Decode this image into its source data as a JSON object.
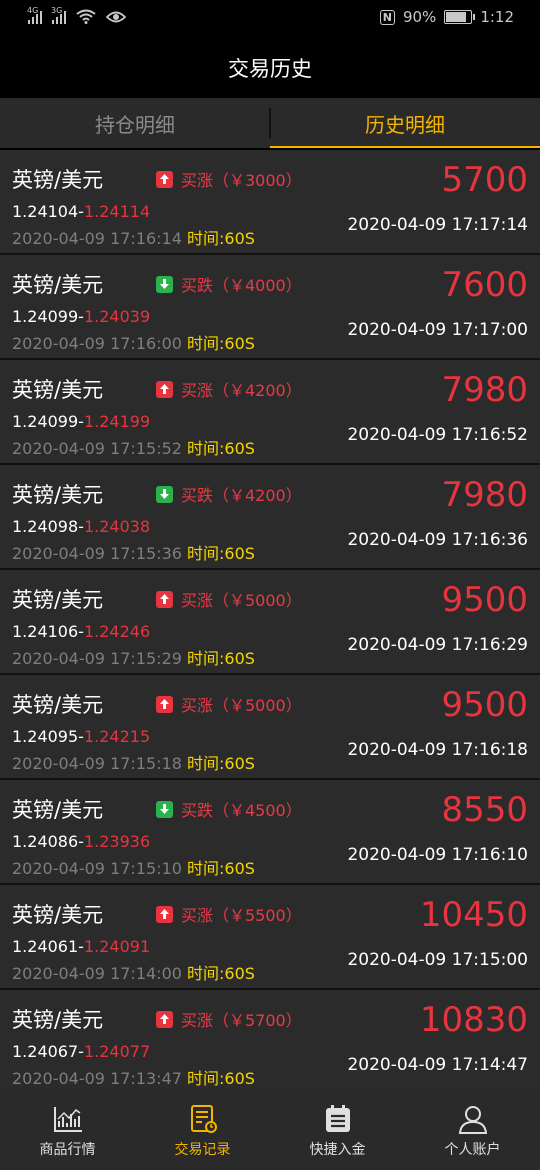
{
  "status_bar": {
    "signal1_tag": "4G",
    "signal2_tag": "3G",
    "battery_percent": "90%",
    "battery_level": 0.9,
    "time": "1:12"
  },
  "header": {
    "title": "交易历史"
  },
  "tabs": [
    {
      "label": "持仓明细",
      "active": false
    },
    {
      "label": "历史明细",
      "active": true
    }
  ],
  "duration_label": "时间:60S",
  "trades": [
    {
      "pair": "英镑/美元",
      "direction": "up",
      "dir_label": "买涨（￥3000）",
      "amount": "5700",
      "open_price": "1.24104",
      "close_price": "1.24114",
      "open_time": "2020-04-09 17:16:14",
      "close_time": "2020-04-09 17:17:14"
    },
    {
      "pair": "英镑/美元",
      "direction": "down",
      "dir_label": "买跌（￥4000）",
      "amount": "7600",
      "open_price": "1.24099",
      "close_price": "1.24039",
      "open_time": "2020-04-09 17:16:00",
      "close_time": "2020-04-09 17:17:00"
    },
    {
      "pair": "英镑/美元",
      "direction": "up",
      "dir_label": "买涨（￥4200）",
      "amount": "7980",
      "open_price": "1.24099",
      "close_price": "1.24199",
      "open_time": "2020-04-09 17:15:52",
      "close_time": "2020-04-09 17:16:52"
    },
    {
      "pair": "英镑/美元",
      "direction": "down",
      "dir_label": "买跌（￥4200）",
      "amount": "7980",
      "open_price": "1.24098",
      "close_price": "1.24038",
      "open_time": "2020-04-09 17:15:36",
      "close_time": "2020-04-09 17:16:36"
    },
    {
      "pair": "英镑/美元",
      "direction": "up",
      "dir_label": "买涨（￥5000）",
      "amount": "9500",
      "open_price": "1.24106",
      "close_price": "1.24246",
      "open_time": "2020-04-09 17:15:29",
      "close_time": "2020-04-09 17:16:29"
    },
    {
      "pair": "英镑/美元",
      "direction": "up",
      "dir_label": "买涨（￥5000）",
      "amount": "9500",
      "open_price": "1.24095",
      "close_price": "1.24215",
      "open_time": "2020-04-09 17:15:18",
      "close_time": "2020-04-09 17:16:18"
    },
    {
      "pair": "英镑/美元",
      "direction": "down",
      "dir_label": "买跌（￥4500）",
      "amount": "8550",
      "open_price": "1.24086",
      "close_price": "1.23936",
      "open_time": "2020-04-09 17:15:10",
      "close_time": "2020-04-09 17:16:10"
    },
    {
      "pair": "英镑/美元",
      "direction": "up",
      "dir_label": "买涨（￥5500）",
      "amount": "10450",
      "open_price": "1.24061",
      "close_price": "1.24091",
      "open_time": "2020-04-09 17:14:00",
      "close_time": "2020-04-09 17:15:00"
    },
    {
      "pair": "英镑/美元",
      "direction": "up",
      "dir_label": "买涨（￥5700）",
      "amount": "10830",
      "open_price": "1.24067",
      "close_price": "1.24077",
      "open_time": "2020-04-09 17:13:47",
      "close_time": "2020-04-09 17:14:47"
    }
  ],
  "bottom_nav": [
    {
      "label": "商品行情",
      "icon": "chart-icon",
      "active": false
    },
    {
      "label": "交易记录",
      "icon": "record-icon",
      "active": true
    },
    {
      "label": "快捷入金",
      "icon": "deposit-icon",
      "active": false
    },
    {
      "label": "个人账户",
      "icon": "user-icon",
      "active": false
    }
  ],
  "colors": {
    "accent": "#f5b400",
    "up": "#e8343f",
    "down": "#2bb24c",
    "duration": "#f5d500"
  }
}
